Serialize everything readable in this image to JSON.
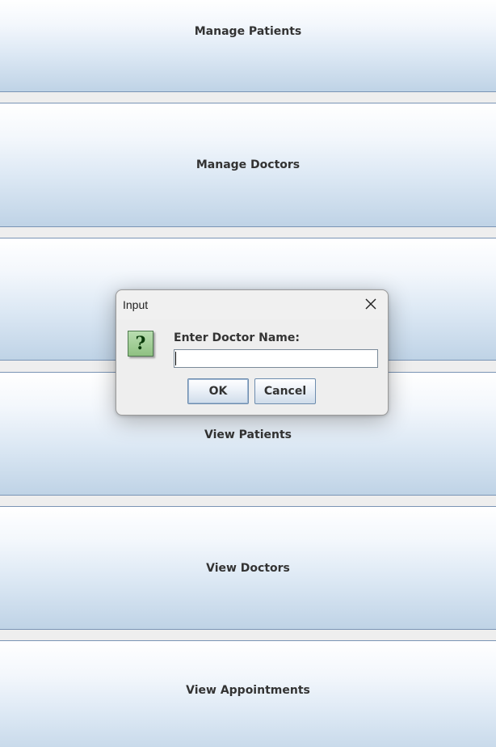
{
  "menu": {
    "manage_patients": "Manage Patients",
    "manage_doctors": "Manage Doctors",
    "view_patients": "View Patients",
    "view_doctors": "View Doctors",
    "view_appointments": "View Appointments"
  },
  "dialog": {
    "title": "Input",
    "prompt": "Enter Doctor Name:",
    "input_value": "",
    "ok_label": "OK",
    "cancel_label": "Cancel",
    "icon": "question-icon",
    "icon_glyph": "?"
  },
  "colors": {
    "button_gradient_top": "#ffffff",
    "button_gradient_bottom": "#bfd3e6",
    "button_border": "#7a94b5",
    "icon_green": "#8fc182"
  }
}
